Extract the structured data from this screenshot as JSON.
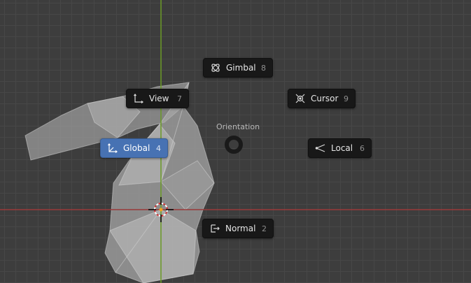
{
  "pie_menu": {
    "title": "Orientation",
    "items": [
      {
        "id": "global",
        "label": "Global",
        "key": "4",
        "icon": "global-axes-icon",
        "active": true
      },
      {
        "id": "local",
        "label": "Local",
        "key": "6",
        "icon": "local-axes-icon",
        "active": false
      },
      {
        "id": "normal",
        "label": "Normal",
        "key": "2",
        "icon": "normal-orientation-icon",
        "active": false
      },
      {
        "id": "gimbal",
        "label": "Gimbal",
        "key": "8",
        "icon": "gimbal-icon",
        "active": false
      },
      {
        "id": "view",
        "label": "View",
        "key": "7",
        "icon": "view-axes-icon",
        "active": false
      },
      {
        "id": "cursor",
        "label": "Cursor",
        "key": "9",
        "icon": "cursor-orientation-icon",
        "active": false
      }
    ]
  },
  "colors": {
    "viewport_bg": "#3d3d3d",
    "grid_line": "#474747",
    "x_axis": "#9a3a3a",
    "y_axis": "#6a9a25",
    "active_button": "#4772b3",
    "button_bg": "#181818",
    "mesh_fill": "#b3b3b3"
  }
}
